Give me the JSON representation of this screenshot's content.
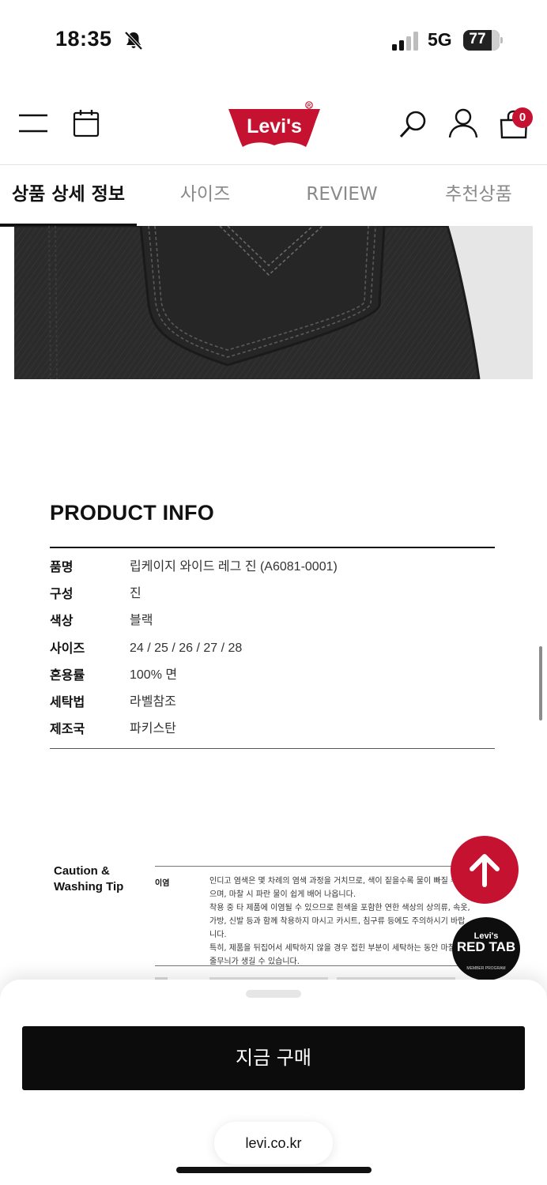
{
  "status_bar": {
    "time": "18:35",
    "network": "5G",
    "battery": "77",
    "icons": [
      "bell-slash-icon",
      "signal-icon",
      "battery-icon"
    ]
  },
  "header": {
    "logo_text": "Levi's",
    "cart_count": "0",
    "brand_color": "#c41230",
    "icons": [
      "menu-icon",
      "calendar-icon",
      "search-icon",
      "user-icon",
      "cart-icon"
    ]
  },
  "tabs": [
    {
      "label": "상품 상세 정보",
      "active": true
    },
    {
      "label": "사이즈",
      "active": false
    },
    {
      "label": "REVIEW",
      "active": false
    },
    {
      "label": "추천상품",
      "active": false
    }
  ],
  "product_info": {
    "title": "PRODUCT INFO",
    "rows": [
      {
        "label": "품명",
        "value": "립케이지 와이드 레그 진 (A6081-0001)"
      },
      {
        "label": "구성",
        "value": "진"
      },
      {
        "label": "색상",
        "value": "블랙"
      },
      {
        "label": "사이즈",
        "value": "24 / 25 / 26 / 27 / 28"
      },
      {
        "label": "혼용률",
        "value": "100% 면"
      },
      {
        "label": "세탁법",
        "value": "라벨참조"
      },
      {
        "label": "제조국",
        "value": "파키스탄"
      }
    ]
  },
  "caution": {
    "title": "Caution & Washing Tip",
    "label": "이염",
    "text": "인디고 염색은 몇 차례의 염색 과정을 거치므로, 색이 짙을수록 물이 빠질 수 있으며, 마찰 시 파란 물이 쉽게 배어 나옵니다.\n착용 중 타 제품에 이염될 수 있으므로 흰색을 포함한 연한 색상의 상의류, 속옷, 가방, 신발 등과 함께 착용하지 마시고 카시트, 침구류 등에도 주의하시기 바랍니다.\n특히, 제품을 뒤집어서 세탁하지 않을 경우 접힌 부분이 세탁하는 동안 마찰되어\n줄무늬가 생길 수 있습니다."
  },
  "floating": {
    "top_button_icon": "arrow-up-icon",
    "red_tab": {
      "brand": "Levi's",
      "title": "RED TAB",
      "subtitle": "MEMBER PROGRAM"
    }
  },
  "bottom_sheet": {
    "buy_label": "지금 구매",
    "url": "levi.co.kr"
  }
}
